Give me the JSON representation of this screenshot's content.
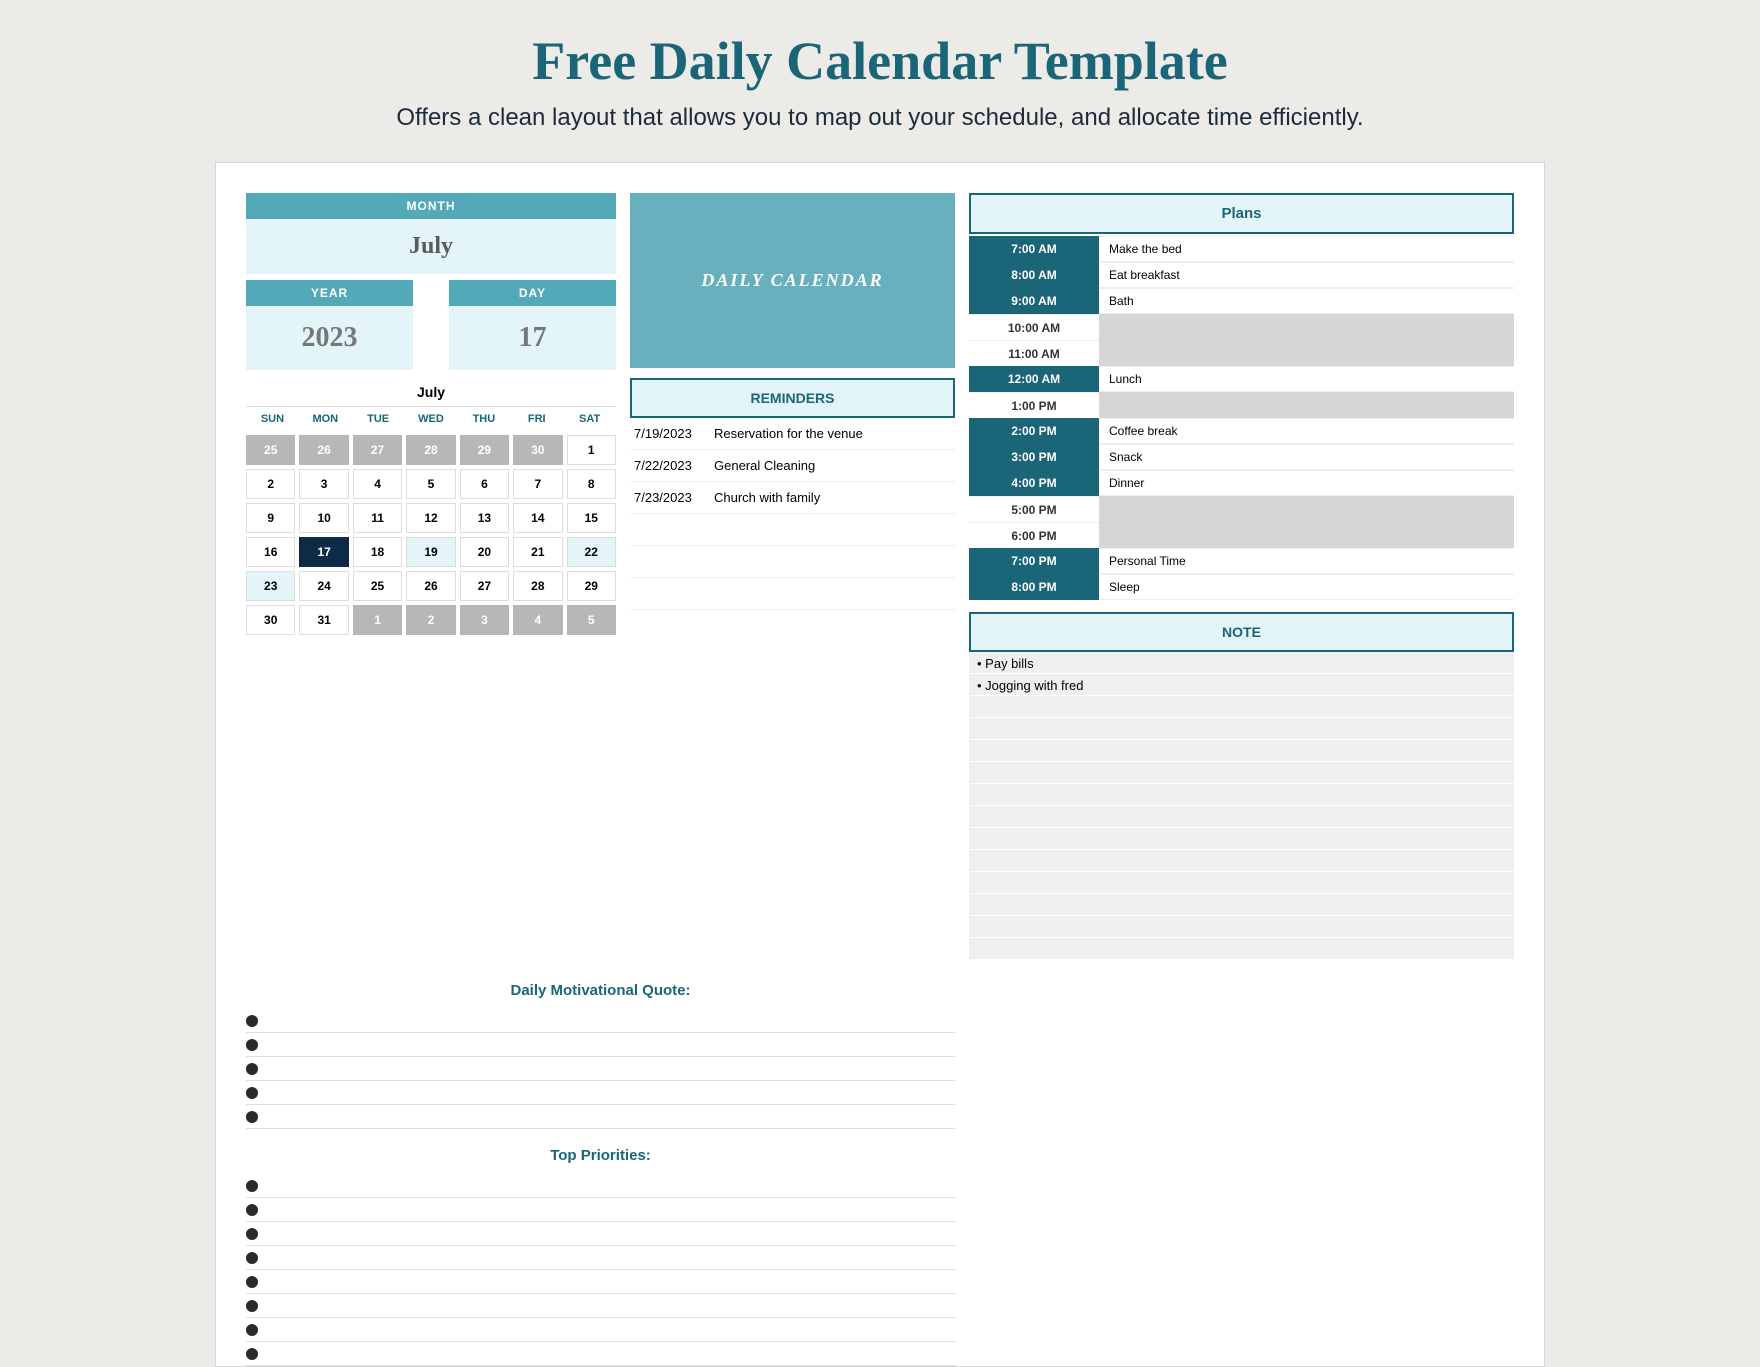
{
  "header": {
    "title": "Free Daily Calendar Template",
    "subtitle": "Offers a clean layout that allows you to map out your schedule, and allocate time efficiently."
  },
  "meta": {
    "month_label": "MONTH",
    "month_value": "July",
    "year_label": "YEAR",
    "year_value": "2023",
    "day_label": "DAY",
    "day_value": "17"
  },
  "daily_label": "DAILY CALENDAR",
  "minical": {
    "month": "July",
    "dow": [
      "SUN",
      "MON",
      "TUE",
      "WED",
      "THU",
      "FRI",
      "SAT"
    ],
    "cells": [
      {
        "n": "25",
        "fade": true
      },
      {
        "n": "26",
        "fade": true
      },
      {
        "n": "27",
        "fade": true
      },
      {
        "n": "28",
        "fade": true
      },
      {
        "n": "29",
        "fade": true
      },
      {
        "n": "30",
        "fade": true
      },
      {
        "n": "1"
      },
      {
        "n": "2"
      },
      {
        "n": "3"
      },
      {
        "n": "4"
      },
      {
        "n": "5"
      },
      {
        "n": "6"
      },
      {
        "n": "7"
      },
      {
        "n": "8"
      },
      {
        "n": "9"
      },
      {
        "n": "10"
      },
      {
        "n": "11"
      },
      {
        "n": "12"
      },
      {
        "n": "13"
      },
      {
        "n": "14"
      },
      {
        "n": "15"
      },
      {
        "n": "16"
      },
      {
        "n": "17",
        "sel": true
      },
      {
        "n": "18"
      },
      {
        "n": "19",
        "hl": true
      },
      {
        "n": "20"
      },
      {
        "n": "21"
      },
      {
        "n": "22",
        "hl": true
      },
      {
        "n": "23",
        "hl": true
      },
      {
        "n": "24"
      },
      {
        "n": "25"
      },
      {
        "n": "26"
      },
      {
        "n": "27"
      },
      {
        "n": "28"
      },
      {
        "n": "29"
      },
      {
        "n": "30"
      },
      {
        "n": "31"
      },
      {
        "n": "1",
        "fade": true
      },
      {
        "n": "2",
        "fade": true
      },
      {
        "n": "3",
        "fade": true
      },
      {
        "n": "4",
        "fade": true
      },
      {
        "n": "5",
        "fade": true
      }
    ]
  },
  "reminders": {
    "title": "REMINDERS",
    "items": [
      {
        "date": "7/19/2023",
        "text": "Reservation for the venue"
      },
      {
        "date": "7/22/2023",
        "text": "General Cleaning"
      },
      {
        "date": "7/23/2023",
        "text": "Church with family"
      }
    ],
    "blank_rows": 3
  },
  "plans": {
    "title": "Plans",
    "rows": [
      {
        "time": "7:00 AM",
        "text": "Make the bed",
        "filled": true
      },
      {
        "time": "8:00 AM",
        "text": "Eat breakfast",
        "filled": true
      },
      {
        "time": "9:00 AM",
        "text": "Bath",
        "filled": true
      },
      {
        "time": "10:00 AM",
        "text": "",
        "filled": false
      },
      {
        "time": "11:00 AM",
        "text": "",
        "filled": false
      },
      {
        "time": "12:00 AM",
        "text": "Lunch",
        "filled": true
      },
      {
        "time": "1:00 PM",
        "text": "",
        "filled": false
      },
      {
        "time": "2:00 PM",
        "text": "Coffee break",
        "filled": true
      },
      {
        "time": "3:00 PM",
        "text": "Snack",
        "filled": true
      },
      {
        "time": "4:00 PM",
        "text": "Dinner",
        "filled": true
      },
      {
        "time": "5:00 PM",
        "text": "",
        "filled": false
      },
      {
        "time": "6:00 PM",
        "text": "",
        "filled": false
      },
      {
        "time": "7:00 PM",
        "text": "Personal Time",
        "filled": true
      },
      {
        "time": "8:00 PM",
        "text": "Sleep",
        "filled": true
      }
    ]
  },
  "quote_title": "Daily Motivational Quote:",
  "priorities_title": "Top Priorities:",
  "quote_lines": 5,
  "priority_lines": 8,
  "note": {
    "title": "NOTE",
    "items": [
      "• Pay bills",
      "• Jogging with fred"
    ],
    "blank_rows": 12
  }
}
